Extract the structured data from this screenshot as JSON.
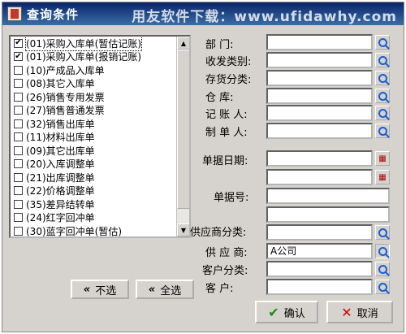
{
  "window": {
    "title": "查询条件",
    "watermark": "用友软件下载：www.ufidawhy.com"
  },
  "doc_types": [
    {
      "label": "(01)采购入库单(暂估记账)",
      "checked": true,
      "selected": true
    },
    {
      "label": "(01)采购入库单(报销记账)",
      "checked": true
    },
    {
      "label": "(10)产成品入库单",
      "checked": false
    },
    {
      "label": "(08)其它入库单",
      "checked": false
    },
    {
      "label": "(26)销售专用发票",
      "checked": false
    },
    {
      "label": "(27)销售普通发票",
      "checked": false
    },
    {
      "label": "(32)销售出库单",
      "checked": false
    },
    {
      "label": "(11)材料出库单",
      "checked": false
    },
    {
      "label": "(09)其它出库单",
      "checked": false
    },
    {
      "label": "(20)入库调整单",
      "checked": false
    },
    {
      "label": "(21)出库调整单",
      "checked": false
    },
    {
      "label": "(22)价格调整单",
      "checked": false
    },
    {
      "label": "(35)差异结转单",
      "checked": false
    },
    {
      "label": "(24)红字回冲单",
      "checked": false
    },
    {
      "label": "(30)蓝字回冲单(暂估)",
      "checked": false
    }
  ],
  "buttons": {
    "deselect": "不选",
    "select_all": "全选",
    "ok": "确认",
    "cancel": "取消"
  },
  "labels": {
    "department": "部    门:",
    "txn_category": "收发类别:",
    "inventory_category": "存货分类:",
    "warehouse": "仓    库:",
    "bookkeeper": "记 账 人:",
    "maker": "制 单 人:",
    "doc_date": "单据日期:",
    "doc_no": "单据号:",
    "supplier_category": "供应商分类:",
    "supplier": "供 应 商:",
    "customer_category": "客户分类:",
    "customer": "客    户:"
  },
  "fields": {
    "department": "",
    "txn_category": "",
    "inventory_category": "",
    "warehouse": "",
    "bookkeeper": "",
    "maker": "",
    "date_from": "",
    "date_to": "",
    "doc_no_from": "",
    "doc_no_to": "",
    "supplier_category": "",
    "supplier": "A公司",
    "customer_category": "",
    "customer": ""
  },
  "icons": {
    "checkbox_checked": "✔",
    "scroll_up": "▲",
    "scroll_down": "▼",
    "cancel_mark": "✕",
    "ok_mark": "✔",
    "deselect": "«",
    "select_all": "«"
  }
}
